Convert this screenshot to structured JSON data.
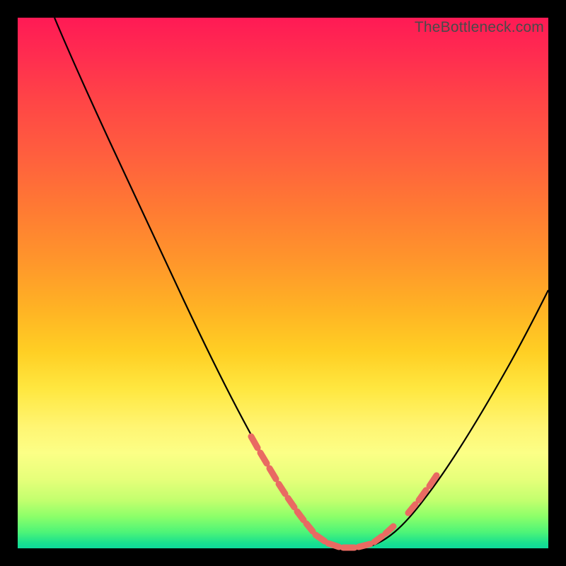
{
  "watermark": "TheBottleneck.com",
  "chart_data": {
    "type": "line",
    "title": "",
    "xlabel": "",
    "ylabel": "",
    "xlim": [
      0,
      100
    ],
    "ylim": [
      0,
      100
    ],
    "grid": false,
    "legend": false,
    "series": [
      {
        "name": "bottleneck-curve",
        "color": "#000000",
        "x": [
          7,
          10,
          14,
          18,
          22,
          26,
          30,
          34,
          38,
          42,
          45,
          48,
          51,
          53,
          55,
          57,
          59,
          61,
          63,
          66,
          69,
          72,
          76,
          80,
          84,
          88,
          92,
          96,
          100
        ],
        "values": [
          100,
          94,
          87,
          79,
          72,
          65,
          58,
          50,
          43,
          35,
          29,
          23,
          17,
          13,
          9,
          6,
          3,
          1,
          0,
          0,
          2,
          5,
          10,
          17,
          25,
          33,
          42,
          51,
          60
        ]
      }
    ],
    "highlight_segments": [
      {
        "name": "left-near-min",
        "x_range": [
          44,
          58
        ],
        "color": "#e96a62"
      },
      {
        "name": "flat-minimum",
        "x_range": [
          58,
          68
        ],
        "color": "#e96a62"
      },
      {
        "name": "right-near-min",
        "x_range": [
          68,
          78
        ],
        "color": "#e96a62"
      }
    ],
    "gradient_stops": [
      {
        "pos": 0,
        "color": "#ff1a55"
      },
      {
        "pos": 50,
        "color": "#ffb324"
      },
      {
        "pos": 80,
        "color": "#fcff86"
      },
      {
        "pos": 100,
        "color": "#0fd99a"
      }
    ]
  }
}
